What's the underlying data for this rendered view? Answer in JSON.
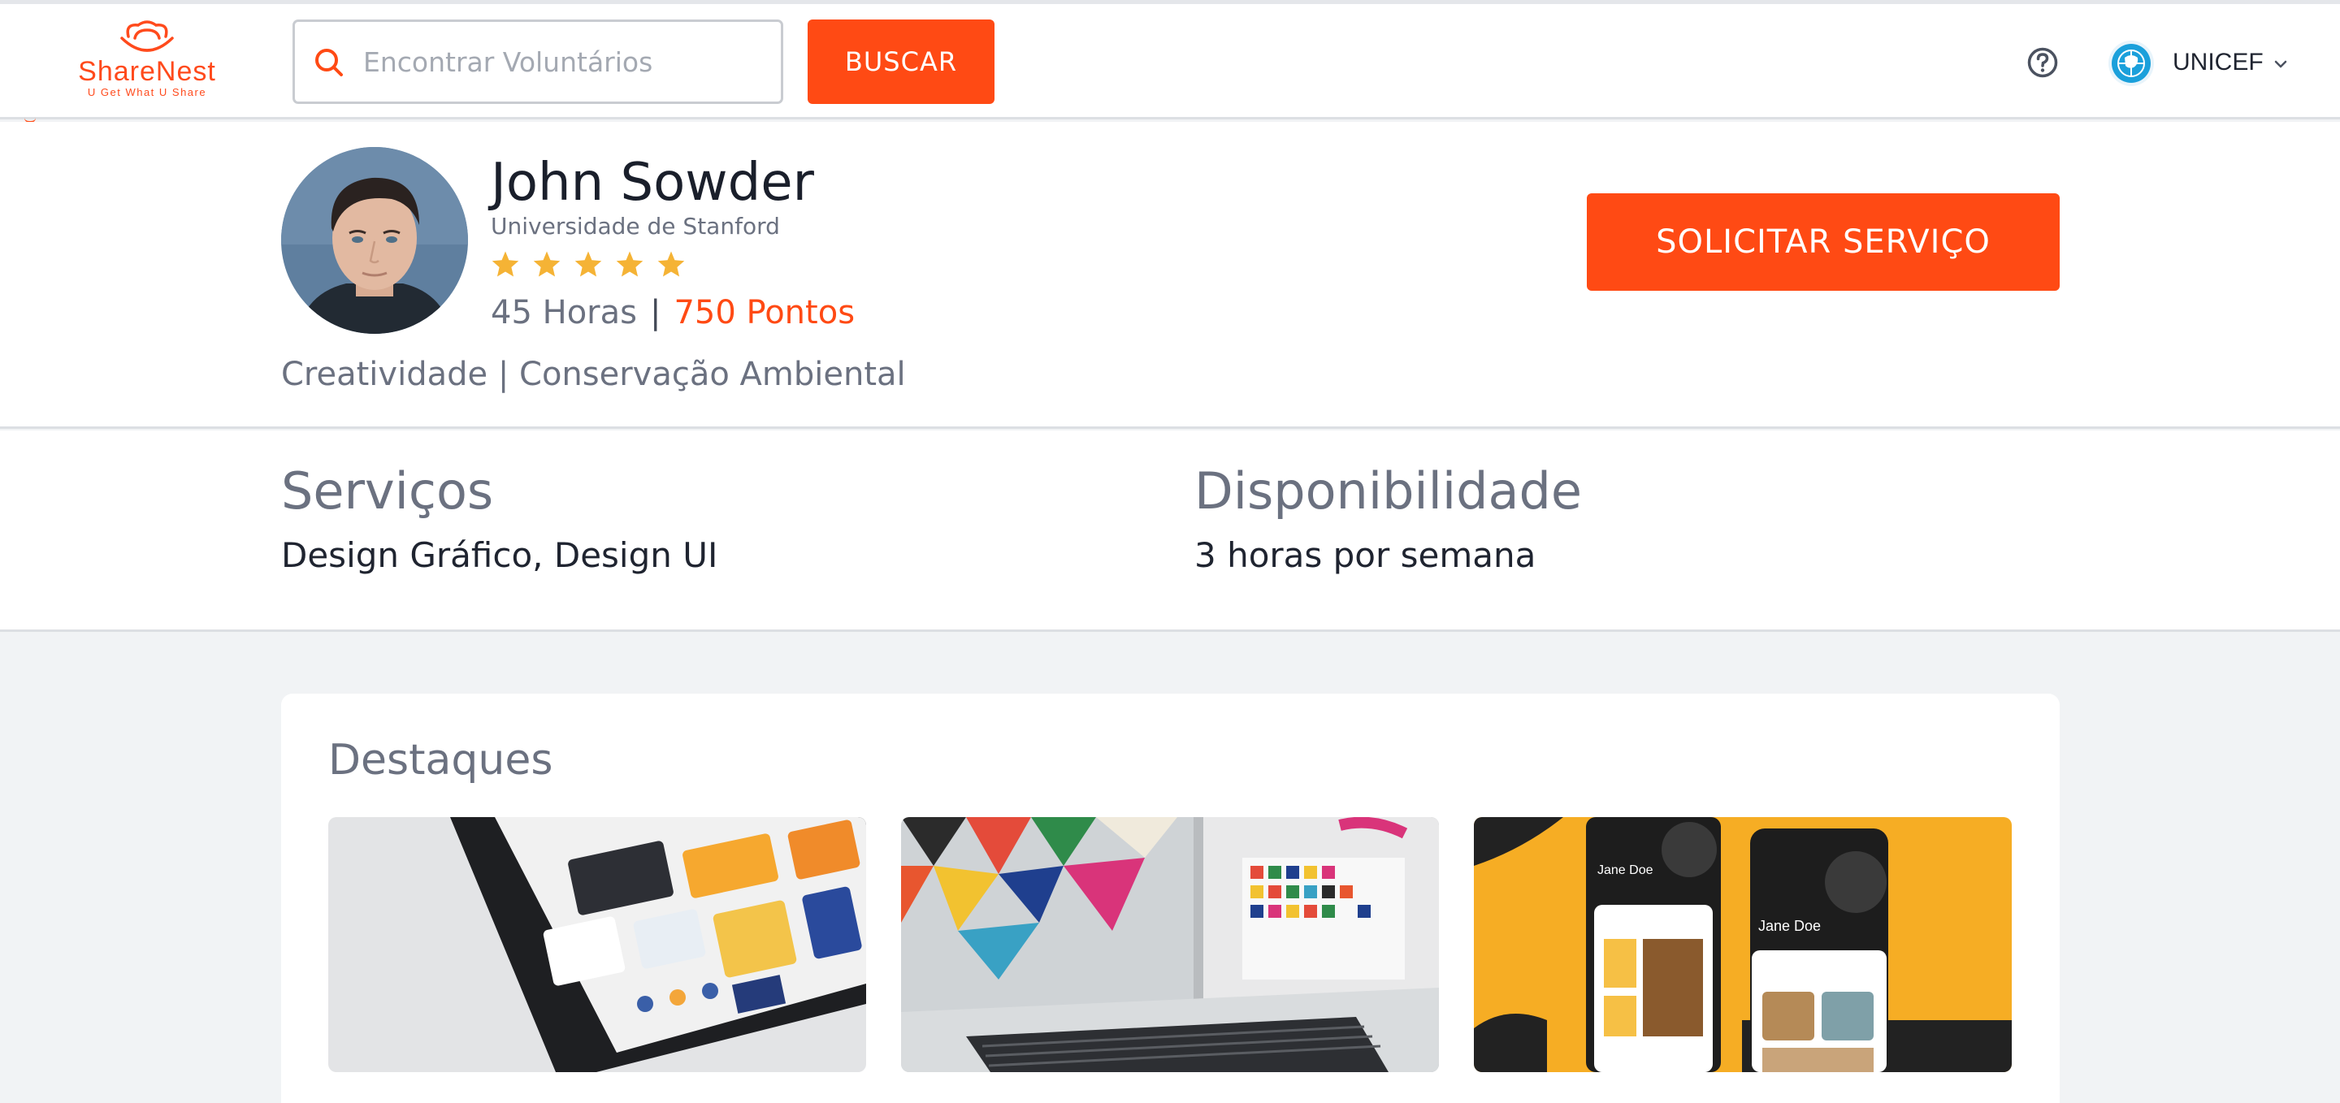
{
  "header": {
    "logo_name": "ShareNest",
    "logo_tagline": "U Get What U Share",
    "search_placeholder": "Encontrar Voluntários",
    "search_button": "BUSCAR",
    "org_name": "UNICEF"
  },
  "profile": {
    "name": "John Sowder",
    "school": "Universidade de Stanford",
    "rating": 5,
    "hours": "45 Horas",
    "separator": "|",
    "points": "750 Pontos",
    "interests": "Creatividade | Conservação Ambiental",
    "request_button": "SOLICITAR SERVIÇO"
  },
  "services": {
    "title": "Serviços",
    "value": "Design Gráfico, Design UI"
  },
  "availability": {
    "title": "Disponibilidade",
    "value": "3 horas por semana"
  },
  "highlights": {
    "title": "Destaques",
    "phone_name_1": "Jane Doe",
    "phone_name_2": "Jane Doe"
  },
  "colors": {
    "accent": "#ff4a14",
    "star": "#f5b335",
    "muted_text": "#6b7180",
    "page_bg": "#f1f3f5"
  },
  "icons": [
    "search-icon",
    "help-icon",
    "chevron-down-icon",
    "star-icon",
    "unicef-logo"
  ]
}
